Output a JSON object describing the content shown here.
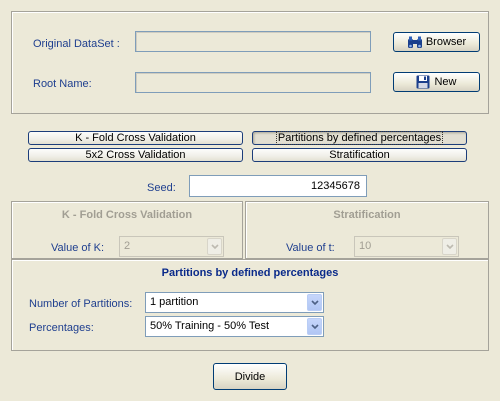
{
  "dataset": {
    "original_label": "Original DataSet :",
    "original_value": "",
    "root_label": "Root Name:",
    "root_value": "",
    "browser_label": "Browser",
    "new_label": "New"
  },
  "methods": {
    "kfold_label": "K - Fold Cross Validation",
    "partitions_label": "Partitions by defined percentages",
    "five_by_two_label": "5x2 Cross Validation",
    "stratification_label": "Stratification",
    "selected": "Partitions by defined percentages"
  },
  "seed": {
    "label": "Seed:",
    "value": "12345678"
  },
  "kfold_panel": {
    "title": "K - Fold Cross Validation",
    "k_label": "Value of K:",
    "k_value": "2"
  },
  "strat_panel": {
    "title": "Stratification",
    "t_label": "Value of t:",
    "t_value": "10"
  },
  "partitions_panel": {
    "title": "Partitions by defined percentages",
    "num_label": "Number of Partitions:",
    "num_value": "1 partition",
    "pct_label": "Percentages:",
    "pct_value": "50% Training - 50% Test"
  },
  "divide_label": "Divide",
  "colors": {
    "background": "#ECE9D8",
    "label_blue": "#1f3f8f",
    "title_blue": "#0a2a8a",
    "disabled_gray": "#a19e93"
  },
  "icons": {
    "browser": "binoculars-icon",
    "new": "floppy-disk-icon",
    "dropdown": "chevron-down-icon"
  }
}
